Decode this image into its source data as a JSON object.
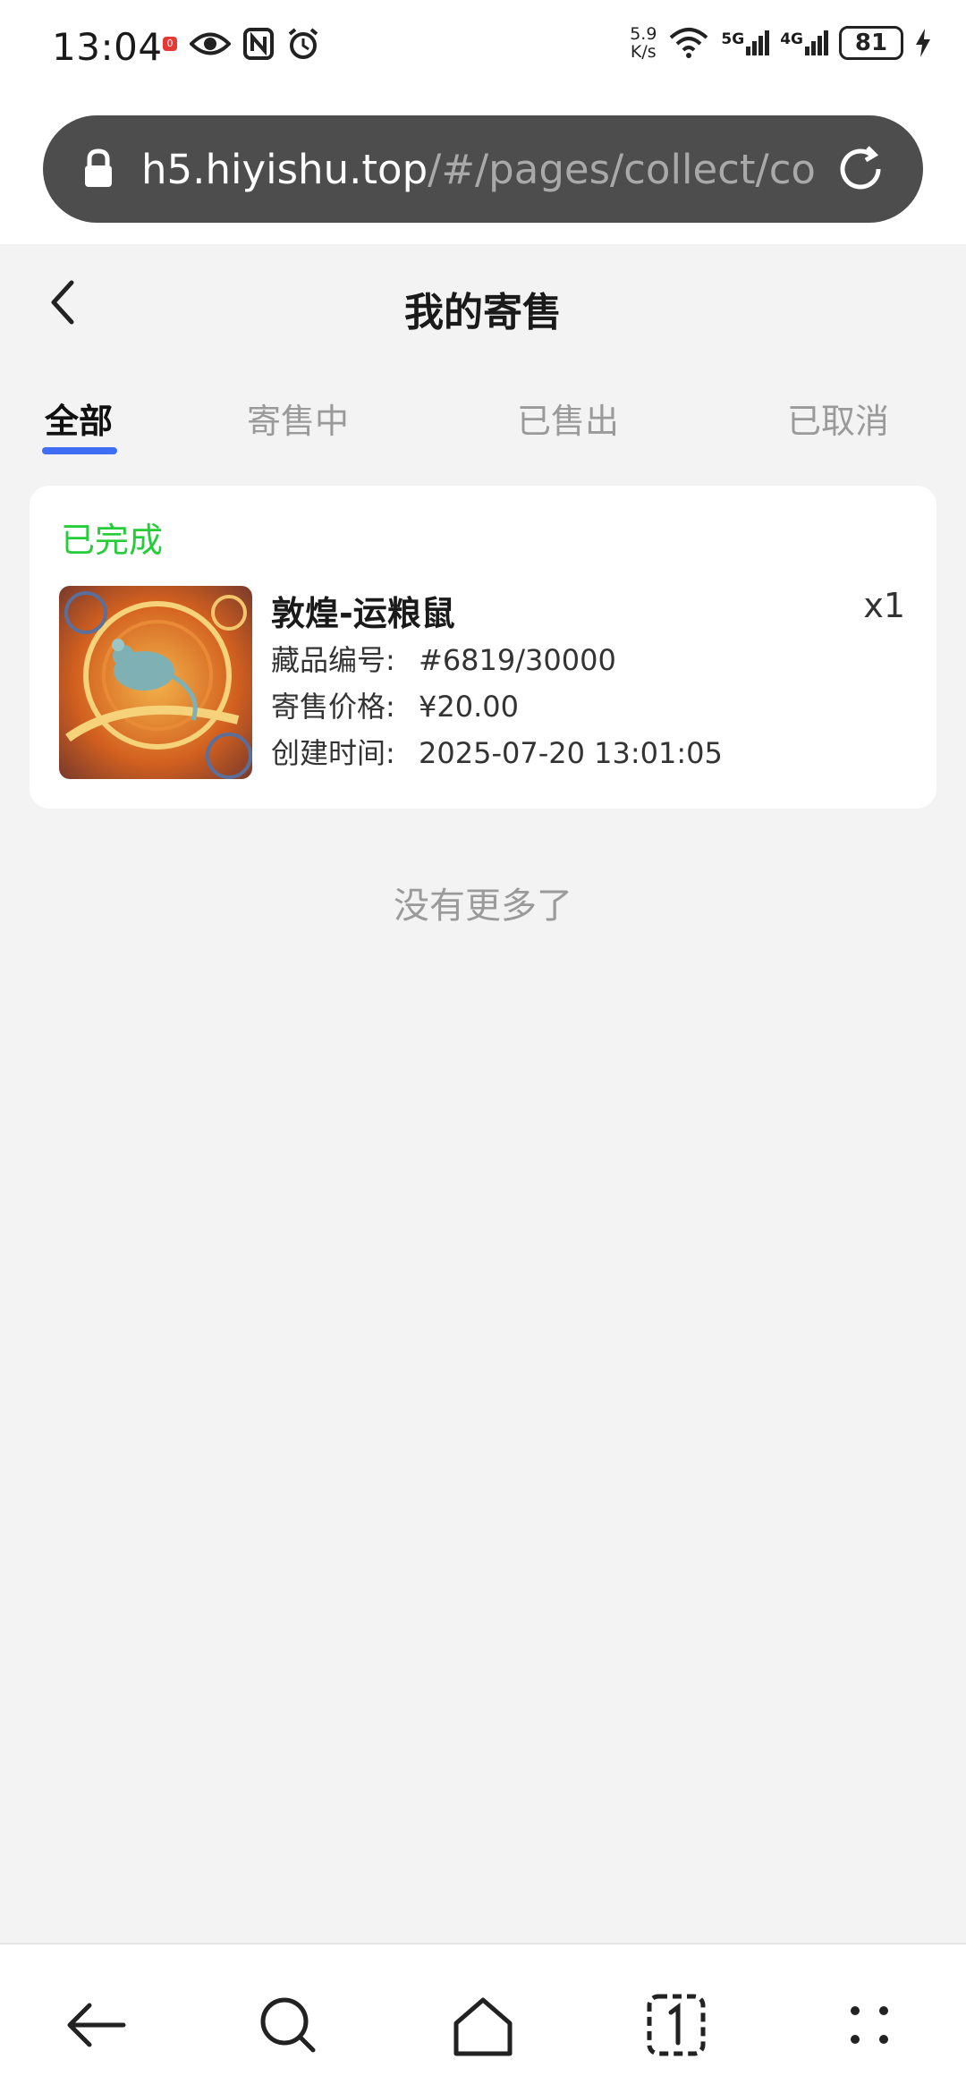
{
  "status_bar": {
    "time": "13:04",
    "notification_badge": "0",
    "net_speed_value": "5.9",
    "net_speed_unit": "K/s",
    "signal_1": "5G",
    "signal_2": "4G",
    "battery": "81"
  },
  "browser": {
    "url_host": "h5.hiyishu.top",
    "url_path": "/#/pages/collect/co"
  },
  "header": {
    "title": "我的寄售"
  },
  "tabs": [
    {
      "label": "全部",
      "active": true
    },
    {
      "label": "寄售中",
      "active": false
    },
    {
      "label": "已售出",
      "active": false
    },
    {
      "label": "已取消",
      "active": false
    }
  ],
  "orders": [
    {
      "status": "已完成",
      "name": "敦煌-运粮鼠",
      "quantity": "x1",
      "serial_label": "藏品编号:",
      "serial_value": "#6819/30000",
      "price_label": "寄售价格:",
      "price_value": "¥20.00",
      "created_label": "创建时间:",
      "created_value": "2025-07-20 13:01:05"
    }
  ],
  "footer_text": "没有更多了",
  "colors": {
    "accent": "#3f6ef5",
    "status_done": "#27cc3a",
    "background": "#f3f3f4"
  }
}
